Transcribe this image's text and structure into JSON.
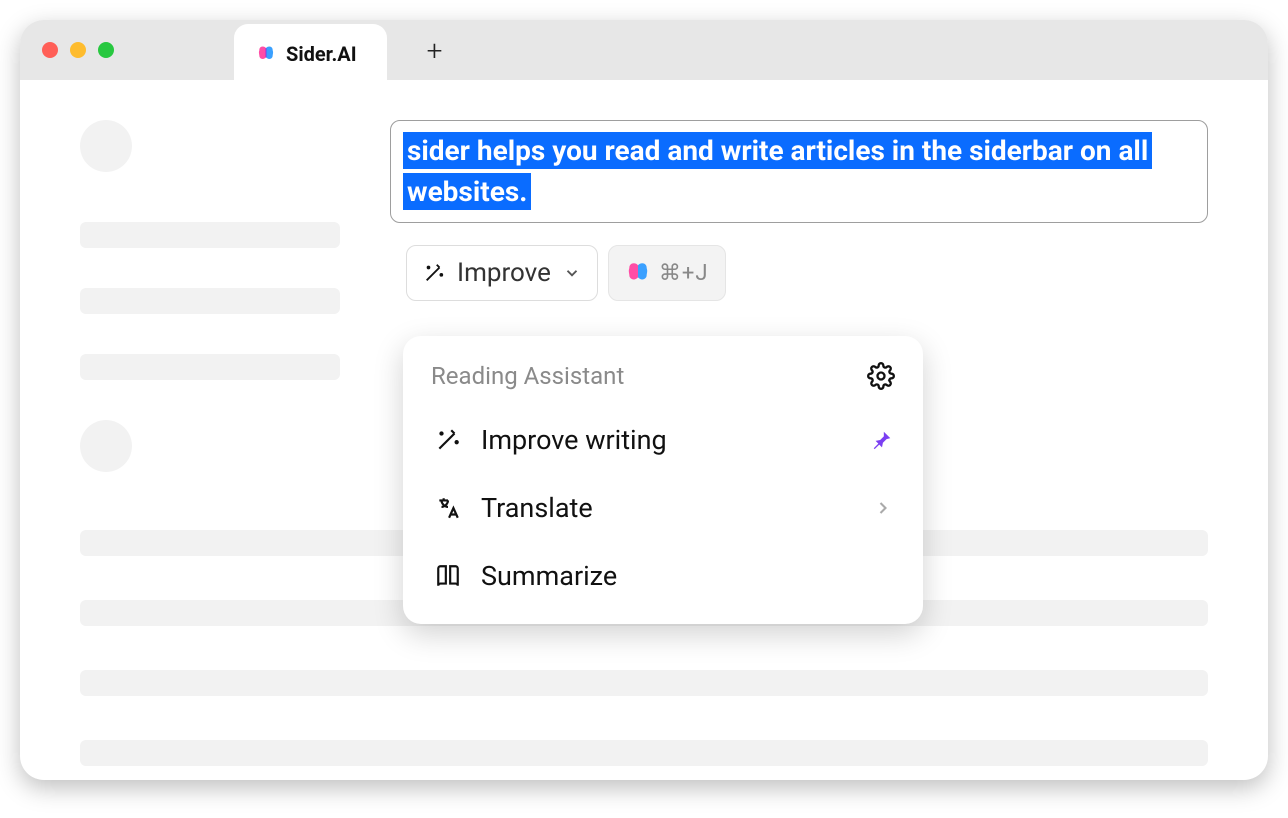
{
  "tab": {
    "title": "Sider.AI"
  },
  "text": {
    "highlighted": "sider helps you read and write articles in the siderbar on all websites."
  },
  "action_pill": {
    "label": "Improve",
    "shortcut": "⌘+J"
  },
  "popup": {
    "heading": "Reading Assistant",
    "items": [
      {
        "label": "Improve writing",
        "icon": "wand",
        "pinned": true,
        "has_submenu": false
      },
      {
        "label": "Translate",
        "icon": "translate",
        "pinned": false,
        "has_submenu": true
      },
      {
        "label": "Summarize",
        "icon": "book",
        "pinned": false,
        "has_submenu": false
      }
    ]
  }
}
